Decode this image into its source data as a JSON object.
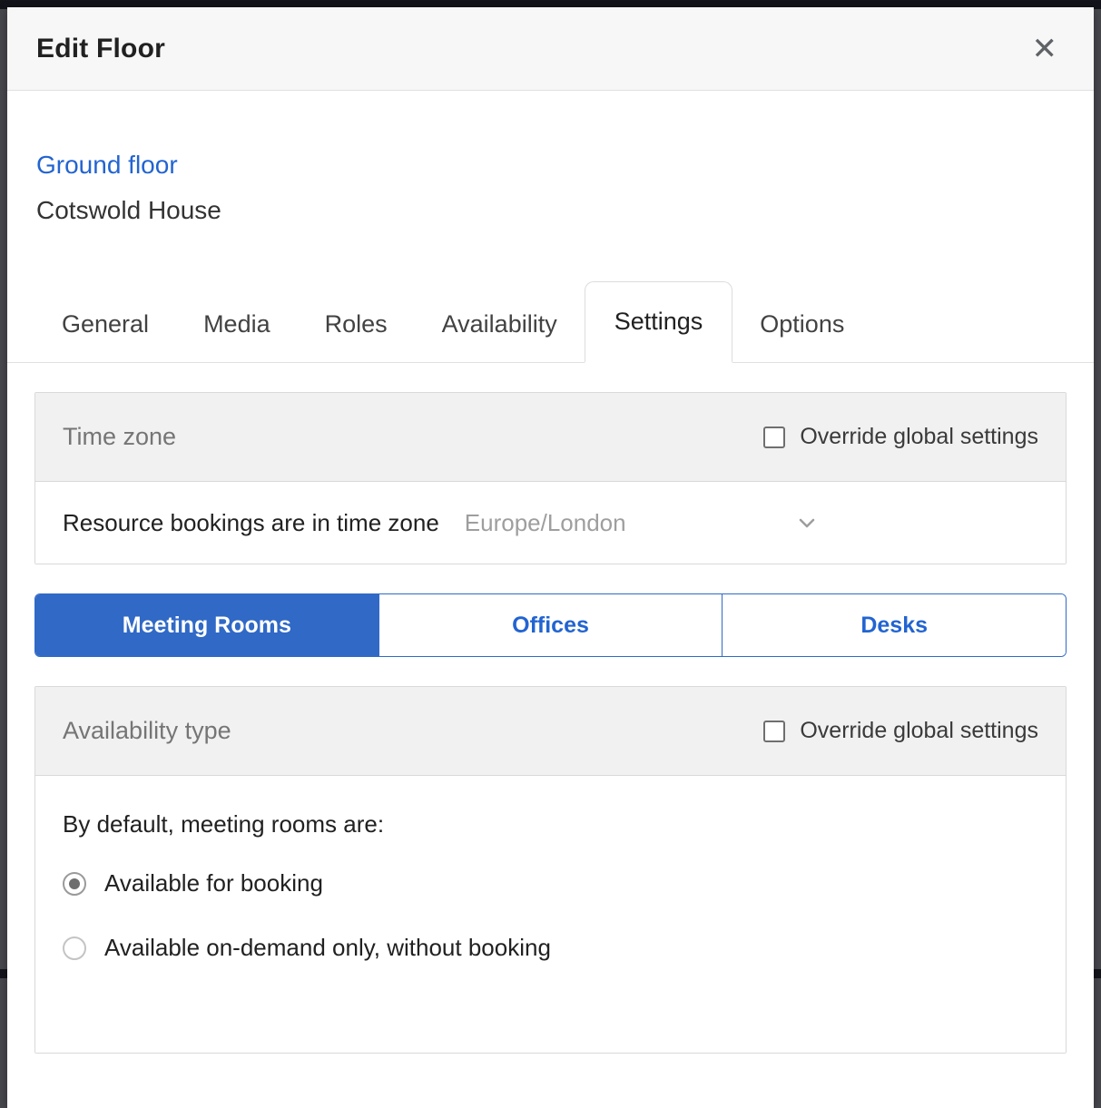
{
  "modal": {
    "title": "Edit Floor",
    "close_glyph": "✕"
  },
  "header": {
    "floor_name": "Ground floor",
    "building_name": "Cotswold House"
  },
  "tabs": {
    "items": [
      {
        "label": "General",
        "active": false
      },
      {
        "label": "Media",
        "active": false
      },
      {
        "label": "Roles",
        "active": false
      },
      {
        "label": "Availability",
        "active": false
      },
      {
        "label": "Settings",
        "active": true
      },
      {
        "label": "Options",
        "active": false
      }
    ]
  },
  "timezone_section": {
    "title": "Time zone",
    "override_label": "Override global settings",
    "override_checked": false,
    "row_label": "Resource bookings are in time zone",
    "selected_value": "Europe/London"
  },
  "resource_tabs": {
    "items": [
      {
        "label": "Meeting Rooms",
        "active": true
      },
      {
        "label": "Offices",
        "active": false
      },
      {
        "label": "Desks",
        "active": false
      }
    ]
  },
  "availability_section": {
    "title": "Availability type",
    "override_label": "Override global settings",
    "override_checked": false,
    "intro": "By default, meeting rooms are:",
    "options": [
      {
        "label": "Available for booking",
        "selected": true
      },
      {
        "label": "Available on-demand only, without booking",
        "selected": false
      }
    ]
  },
  "colors": {
    "accent_blue": "#2264d1",
    "segment_active_bg": "#3069c6",
    "section_header_bg": "#f1f1f1",
    "muted_text": "#757575"
  }
}
